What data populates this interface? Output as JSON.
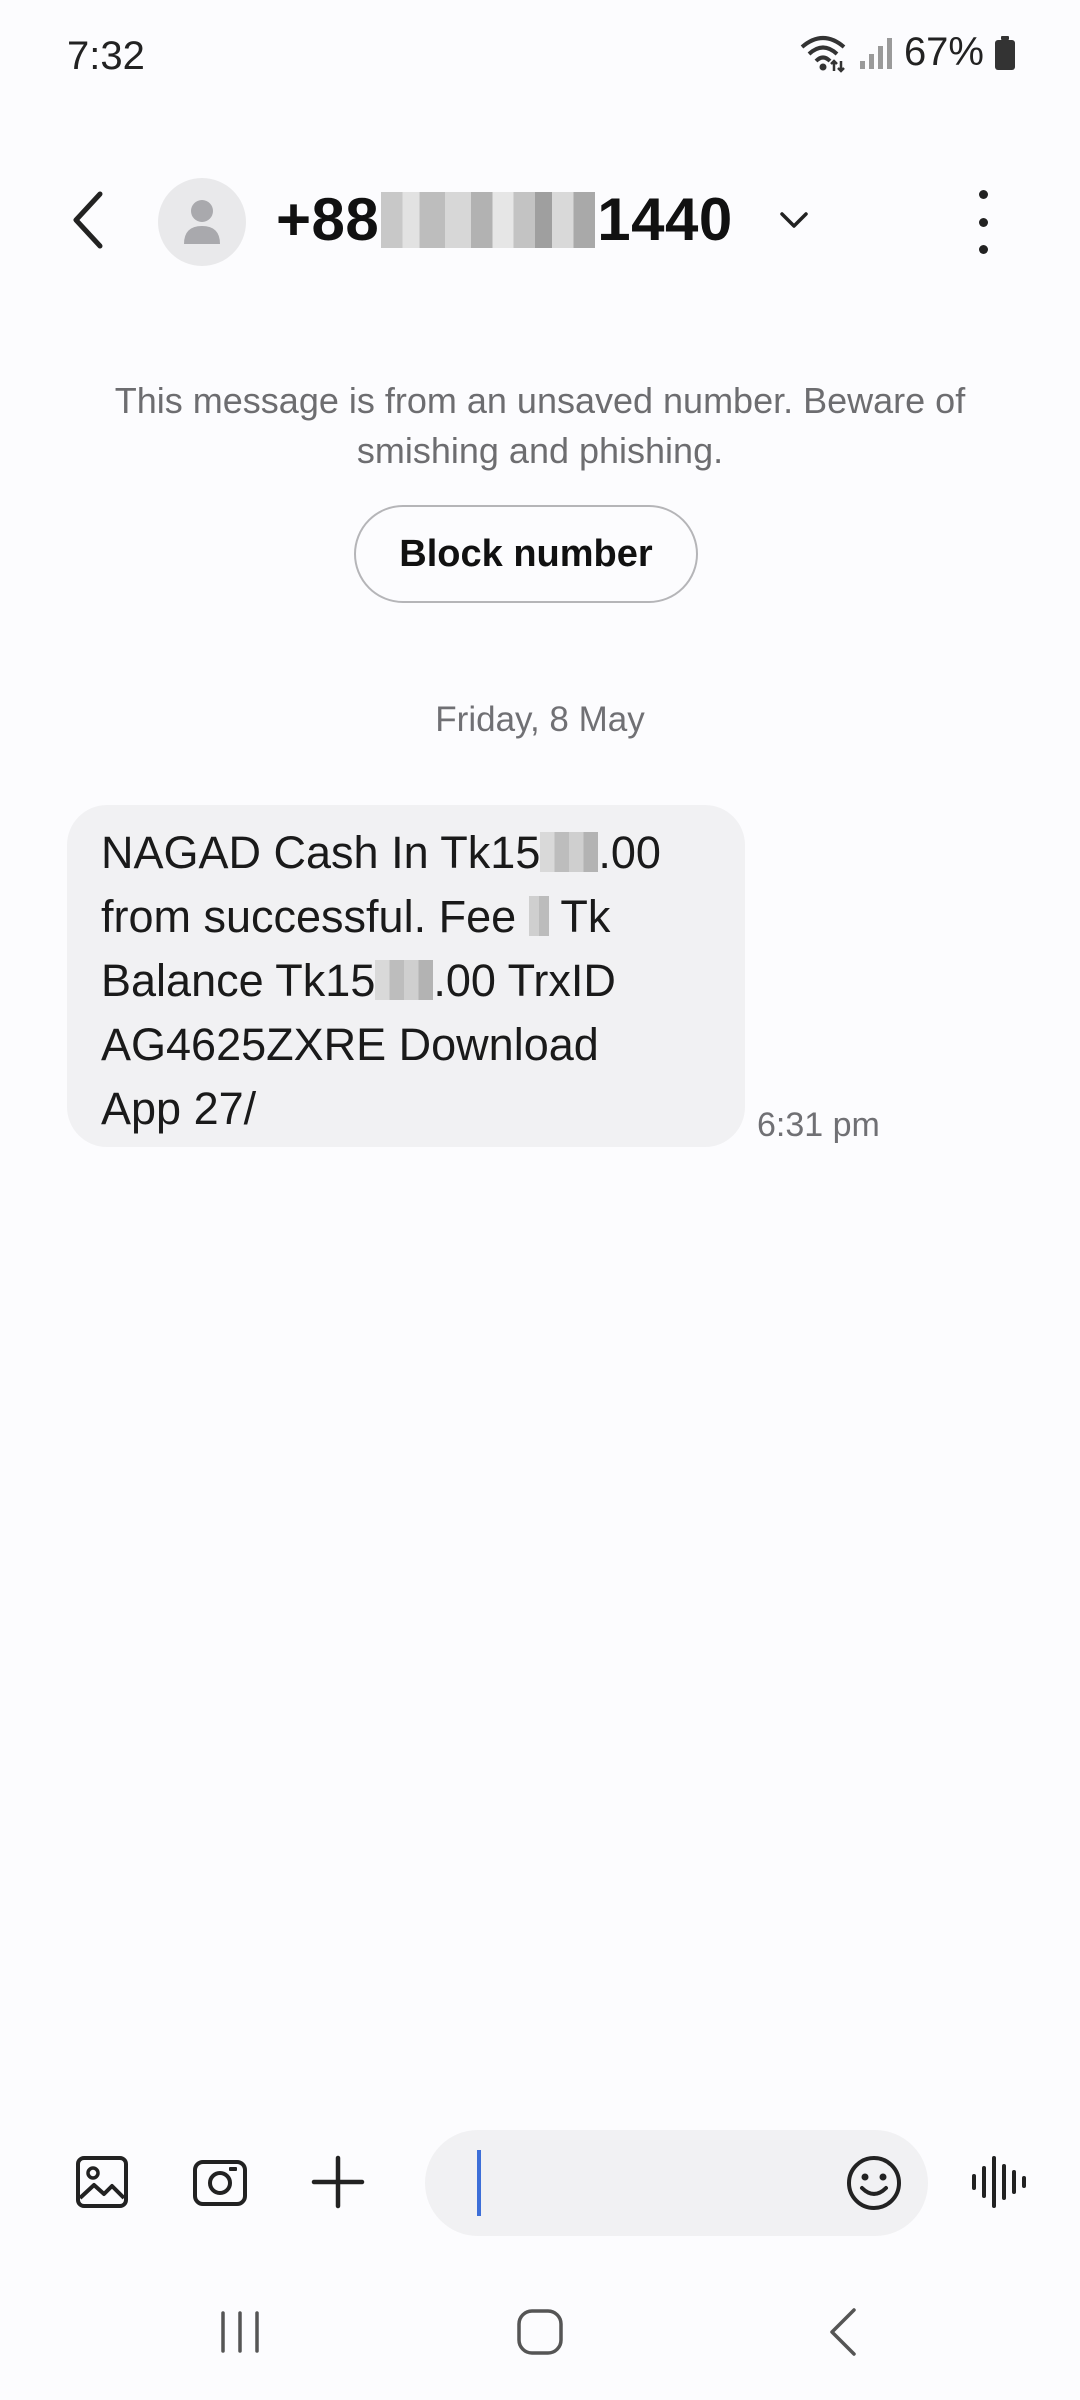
{
  "status_bar": {
    "time": "7:32",
    "battery_percent": "67%",
    "icons": [
      "wifi-icon",
      "signal-icon",
      "battery-icon"
    ]
  },
  "header": {
    "contact_prefix": "+88",
    "contact_suffix": "1440",
    "icons": [
      "back-arrow-icon",
      "avatar-person-icon",
      "chevron-down-icon",
      "more-options-icon"
    ]
  },
  "warning": {
    "text": "This message is from an unsaved number. Beware of smishing and phishing.",
    "block_button": "Block number"
  },
  "conversation": {
    "date": "Friday, 8 May",
    "messages": [
      {
        "lines": [
          [
            "NAGAD Cash In Tk15",
            ".00"
          ],
          [
            "from successful. Fee ",
            " Tk"
          ],
          [
            "Balance Tk15",
            ".00 TrxID"
          ],
          [
            "AG4625ZXRE  Download",
            ""
          ],
          [
            "App 27/",
            ""
          ]
        ],
        "time": "6:31 pm"
      }
    ]
  },
  "composer": {
    "input_value": "",
    "icons": [
      "gallery-icon",
      "camera-icon",
      "plus-icon",
      "emoji-icon",
      "voice-record-icon"
    ]
  },
  "nav_bar": {
    "icons": [
      "recent-apps-icon",
      "home-icon",
      "back-nav-icon"
    ]
  },
  "colors": {
    "background": "#fcfcfe",
    "bubble": "#f1f1f3",
    "cursor": "#3d6fd8"
  }
}
